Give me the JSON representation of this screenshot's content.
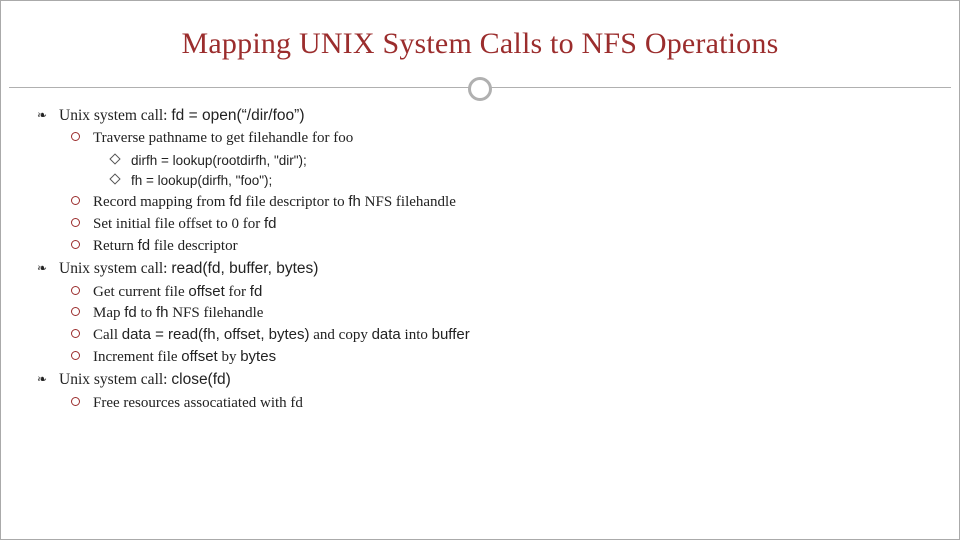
{
  "title": "Mapping UNIX System Calls to NFS Operations",
  "sections": [
    {
      "head_pre": "Unix system call: ",
      "head_code": "fd = open(“/dir/foo”)",
      "items": [
        {
          "text": "Traverse pathname to get filehandle for foo",
          "sub": [
            "dirfh = lookup(rootdirfh, \"dir\");",
            "fh = lookup(dirfh, \"foo\");"
          ]
        },
        {
          "text_html": "Record mapping from <span class='sans'>fd</span> file descriptor to <span class='sans'>fh</span> NFS filehandle"
        },
        {
          "text_html": "Set initial file offset to 0 for <span class='sans'>fd</span>"
        },
        {
          "text_html": "Return <span class='sans'>fd</span> file descriptor"
        }
      ]
    },
    {
      "head_pre": "Unix system call: ",
      "head_code": "read(fd, buffer, bytes)",
      "items": [
        {
          "text_html": "Get current file <span class='sans'>offset</span> for <span class='sans'>fd</span>"
        },
        {
          "text_html": "Map <span class='sans'>fd</span> to <span class='sans'>fh</span> NFS filehandle"
        },
        {
          "text_html": "Call <span class='sans'>data = read(fh, offset, bytes)</span> and copy <span class='sans'>data</span> into <span class='sans'>buffer</span>"
        },
        {
          "text_html": "Increment file <span class='sans'>offset</span> by <span class='sans'>bytes</span>"
        }
      ]
    },
    {
      "head_pre": "Unix system call: ",
      "head_code": "close(fd)",
      "items": [
        {
          "text_html": "Free resources assocatiated with fd"
        }
      ]
    }
  ]
}
